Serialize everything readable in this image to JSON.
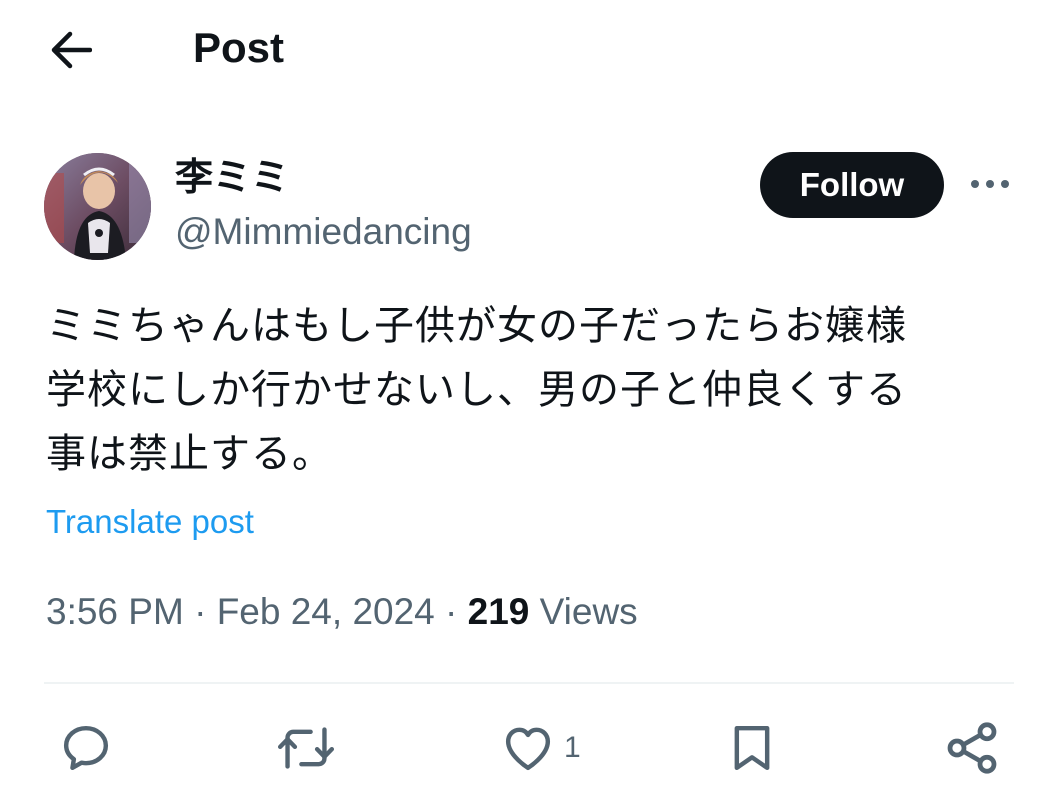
{
  "header": {
    "title": "Post",
    "back_icon": "arrow-left-icon"
  },
  "author": {
    "display_name": "李ミミ",
    "handle": "@Mimmiedancing",
    "avatar": "avatar-photo"
  },
  "follow_button": {
    "label": "Follow"
  },
  "more_icon": "more-horizontal-icon",
  "post": {
    "lines": [
      "ミミちゃんはもし子供が女の子だったらお嬢様",
      "学校にしか行かせないし、男の子と仲良くする",
      "事は禁止する。"
    ],
    "translate_label": "Translate post"
  },
  "meta": {
    "time": "3:56 PM",
    "separator1": " · ",
    "date": "Feb 24, 2024",
    "separator2": " · ",
    "views_count": "219",
    "views_label": " Views"
  },
  "actions": {
    "reply_icon": "reply-icon",
    "retweet_icon": "retweet-icon",
    "like_icon": "heart-icon",
    "like_count": "1",
    "bookmark_icon": "bookmark-icon",
    "share_icon": "share-icon"
  },
  "colors": {
    "text": "#0f1419",
    "secondary": "#536471",
    "link": "#1d9bf0",
    "button_bg": "#0f1419",
    "divider": "#eff3f4"
  }
}
